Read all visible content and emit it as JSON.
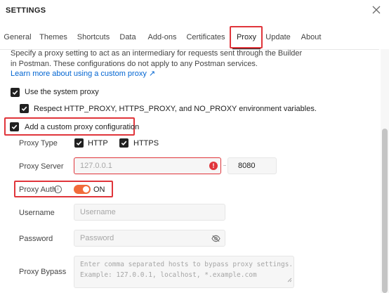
{
  "window": {
    "title": "SETTINGS"
  },
  "tabs": [
    {
      "label": "General"
    },
    {
      "label": "Themes"
    },
    {
      "label": "Shortcuts"
    },
    {
      "label": "Data"
    },
    {
      "label": "Add-ons"
    },
    {
      "label": "Certificates"
    },
    {
      "label": "Proxy"
    },
    {
      "label": "Update"
    },
    {
      "label": "About"
    }
  ],
  "active_tab": "Proxy",
  "proxy": {
    "description_line1": "Specify a proxy setting to act as an intermediary for requests sent through the Builder",
    "description_line2": "in Postman. These configurations do not apply to any Postman services.",
    "learn_more": "Learn more about using a custom proxy ↗",
    "use_system_proxy": {
      "label": "Use the system proxy",
      "checked": true
    },
    "respect_env": {
      "label": "Respect HTTP_PROXY, HTTPS_PROXY, and NO_PROXY environment variables.",
      "checked": true
    },
    "custom_proxy": {
      "label": "Add a custom proxy configuration",
      "checked": true
    },
    "proxy_type": {
      "label": "Proxy Type",
      "http": {
        "label": "HTTP",
        "checked": true
      },
      "https": {
        "label": "HTTPS",
        "checked": true
      }
    },
    "proxy_server": {
      "label": "Proxy Server",
      "host_placeholder": "127.0.0.1",
      "port_value": "8080"
    },
    "proxy_auth": {
      "label": "Proxy Auth",
      "toggle_text": "ON",
      "on": true
    },
    "username": {
      "label": "Username",
      "placeholder": "Username"
    },
    "password": {
      "label": "Password",
      "placeholder": "Password"
    },
    "proxy_bypass": {
      "label": "Proxy Bypass",
      "placeholder_line1": "Enter comma separated hosts to bypass proxy settings.",
      "placeholder_line2": "Example: 127.0.0.1, localhost, *.example.com"
    }
  },
  "colors": {
    "accent": "#f26b3a",
    "highlight_border": "#e0353b",
    "link": "#0265d2",
    "error_icon": "#e0353b"
  }
}
